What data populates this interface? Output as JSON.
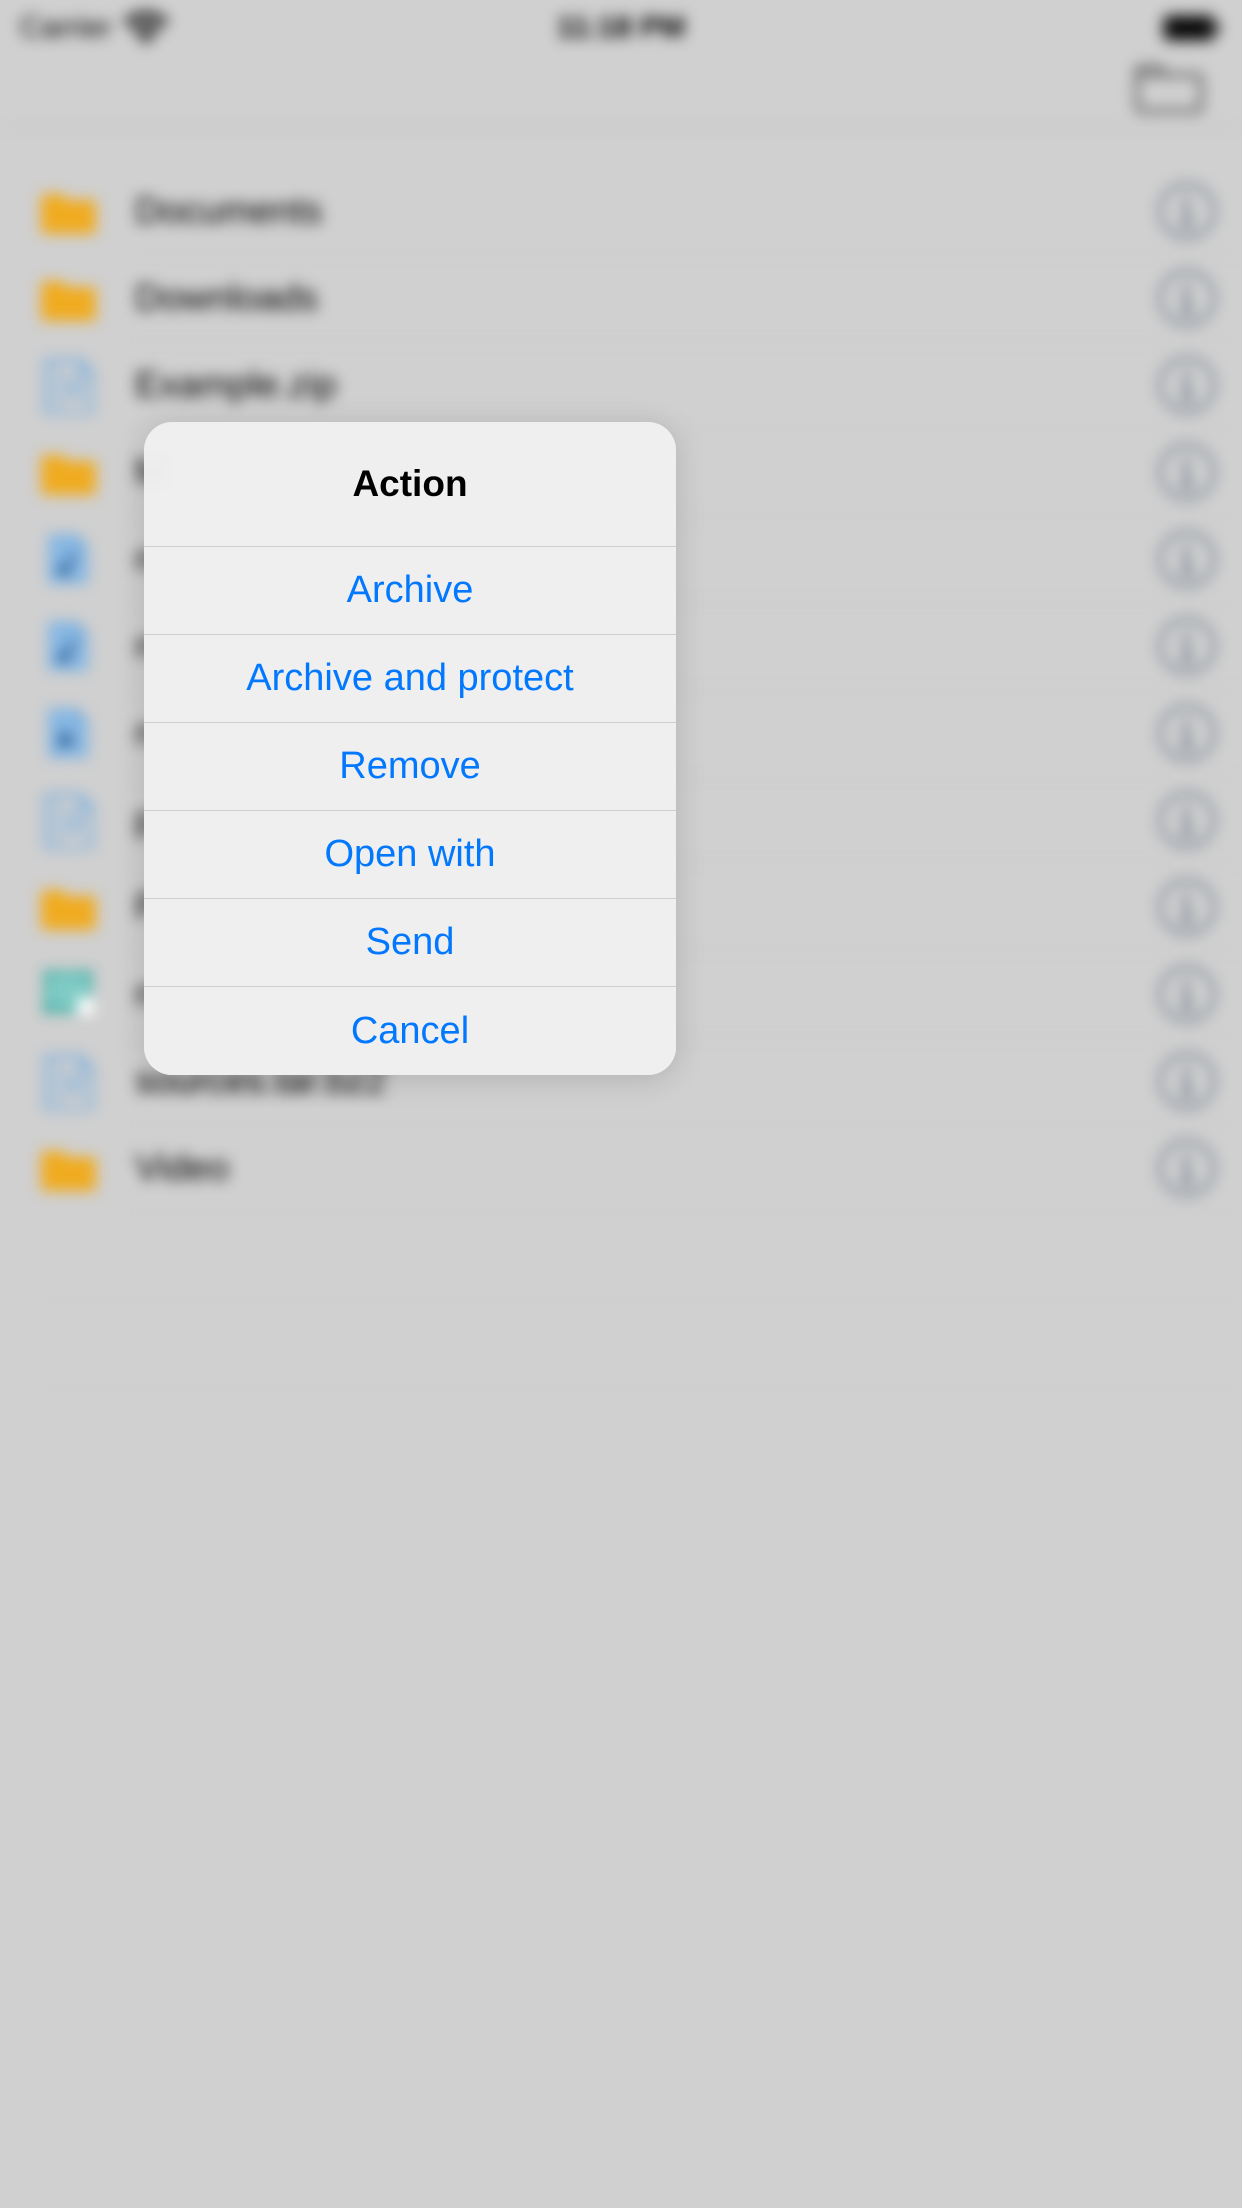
{
  "status_bar": {
    "carrier": "Carrier",
    "time": "11:18 PM"
  },
  "files": [
    {
      "name": "Documents",
      "type": "folder"
    },
    {
      "name": "Downloads",
      "type": "folder"
    },
    {
      "name": "Example.zip",
      "type": "archive"
    },
    {
      "name": "M",
      "type": "folder"
    },
    {
      "name": "n",
      "type": "audio"
    },
    {
      "name": "n",
      "type": "audio"
    },
    {
      "name": "n",
      "type": "video"
    },
    {
      "name": "p",
      "type": "archive"
    },
    {
      "name": "P",
      "type": "folder"
    },
    {
      "name": "n",
      "type": "sheet"
    },
    {
      "name": "sources.tar.bz2",
      "type": "archive"
    },
    {
      "name": "Video",
      "type": "folder"
    }
  ],
  "action_sheet": {
    "title": "Action",
    "items": [
      "Archive",
      "Archive and protect",
      "Remove",
      "Open with",
      "Send",
      "Cancel"
    ]
  }
}
